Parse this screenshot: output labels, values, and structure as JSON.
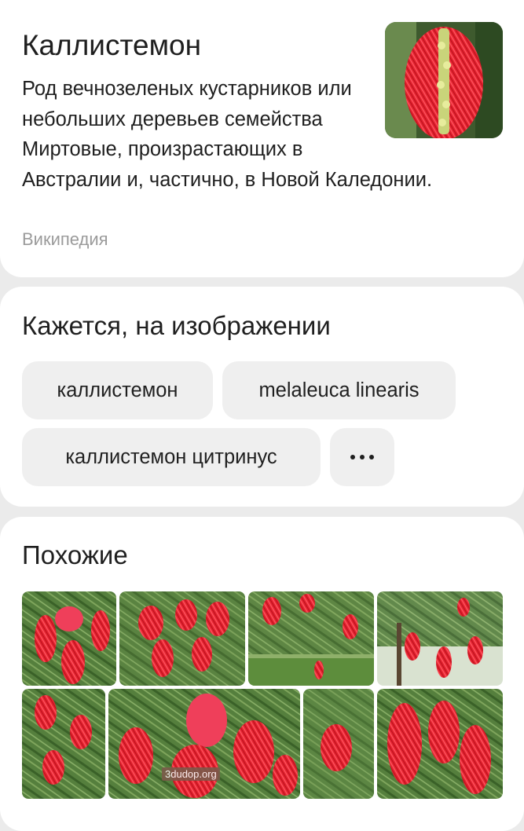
{
  "wiki": {
    "title": "Каллистемон",
    "description": "Род вечнозеленых кустарников или небольших деревьев семейства Миртовые, произрастающих в Австралии и, частично, в Новой Каледонии.",
    "source": "Википедия"
  },
  "guess": {
    "title": "Кажется, на изображении",
    "chips": [
      "каллистемон",
      "melaleuca linearis",
      "каллистемон цитринус"
    ],
    "more_icon": "more-horizontal-icon"
  },
  "similar": {
    "title": "Похожие",
    "watermark": "3dudop.org"
  },
  "colors": {
    "background": "#ebebeb",
    "card": "#ffffff",
    "chip": "#efefef",
    "muted_text": "#9b9b9b",
    "flower_red": "#e0202e",
    "foliage_green": "#4f7a3a"
  }
}
